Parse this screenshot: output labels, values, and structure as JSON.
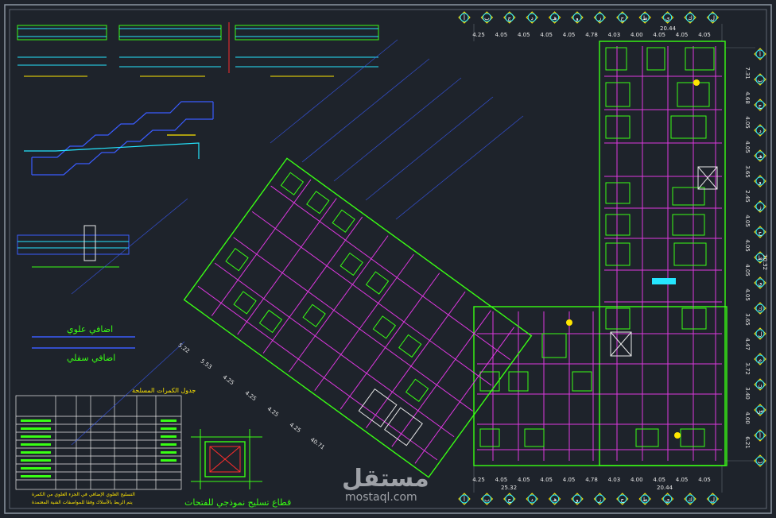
{
  "watermark": {
    "arabic": "مستقل",
    "latin": "mostaql.com"
  },
  "notes": {
    "upper_reinforcement": "اضافي علوي",
    "lower_reinforcement": "اضافي سفلي",
    "legend_title": "جدول الكمرات المسلحة",
    "section_title": "قطاع تسليح نموذجي للفتحات",
    "footnote_1": "التسليح العلوي الإضافي في الجزء العلوي من الكمرة",
    "footnote_2": "يتم الربط بالأسلاك وفقا للمواصفات الفنية المعتمدة"
  },
  "dimensions": {
    "top": [
      "4.25",
      "4.05",
      "4.05",
      "4.05",
      "4.05",
      "4.78",
      "4.03",
      "4.00",
      "4.05",
      "4.05",
      "4.05"
    ],
    "top_total": "20.44",
    "bottom": [
      "4.25",
      "4.05",
      "4.05",
      "4.05",
      "4.05",
      "4.78",
      "4.03",
      "4.00",
      "4.05",
      "4.05",
      "4.05"
    ],
    "bottom_total_left": "25.32",
    "bottom_total_right": "20.44",
    "right": [
      "7.31",
      "4.68",
      "4.05",
      "4.05",
      "3.65",
      "2.45",
      "4.05",
      "4.05",
      "4.05",
      "4.05",
      "3.65",
      "4.47",
      "3.72",
      "3.40",
      "4.00",
      "6.21"
    ],
    "right_total": "70.32",
    "diagonal": [
      "5.22",
      "5.53",
      "4.25",
      "4.25",
      "4.25",
      "4.25",
      "40.71"
    ]
  },
  "axis_letters": [
    "أ",
    "ب",
    "ج",
    "د",
    "هـ",
    "و",
    "ز",
    "ح",
    "ط",
    "ي",
    "ك",
    "ل",
    "م",
    "ن",
    "س"
  ],
  "colors": {
    "background": "#1e232b",
    "green": "#39ff14",
    "magenta": "#ff3cff",
    "cyan": "#25e6ff",
    "yellow": "#ffe600",
    "blue": "#3a5cff",
    "red": "#ff2d2d",
    "white": "#e8e8e8"
  }
}
